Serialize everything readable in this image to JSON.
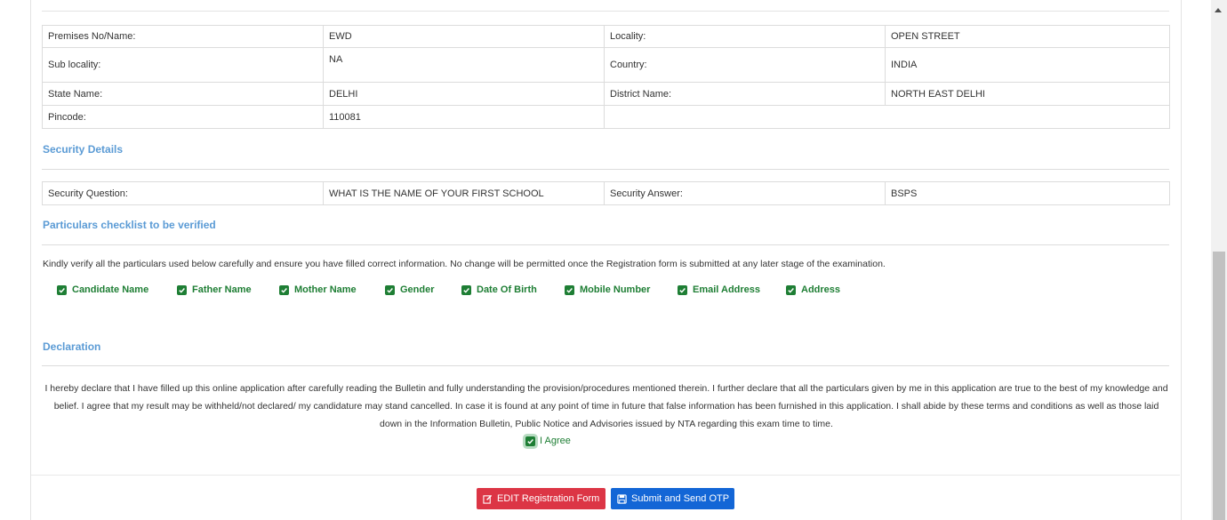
{
  "address_table": [
    {
      "label1": "Premises No/Name:",
      "value1": "EWD",
      "label2": "Locality:",
      "value2": "OPEN STREET"
    },
    {
      "label1": "Sub locality:",
      "value1": "NA",
      "label2": "Country:",
      "value2": "INDIA"
    },
    {
      "label1": "State Name:",
      "value1": "DELHI",
      "label2": "District Name:",
      "value2": "NORTH EAST DELHI"
    },
    {
      "label1": "Pincode:",
      "value1": "110081",
      "label2": "",
      "value2": ""
    }
  ],
  "security": {
    "title": "Security Details",
    "question_label": "Security Question:",
    "question_value": "WHAT IS THE NAME OF YOUR FIRST SCHOOL",
    "answer_label": "Security Answer:",
    "answer_value": "BSPS"
  },
  "checklist": {
    "title": "Particulars checklist to be verified",
    "instruction": "Kindly verify all the particulars used below carefully and ensure you have filled correct information. No change will be permitted once the Registration form is submitted at any later stage of the examination.",
    "items": [
      "Candidate Name",
      "Father Name",
      "Mother Name",
      "Gender",
      "Date Of Birth",
      "Mobile Number",
      "Email Address",
      "Address"
    ]
  },
  "declaration": {
    "title": "Declaration",
    "text": "I hereby declare that I have filled up this online application after carefully reading the Bulletin and fully understanding the provision/procedures mentioned therein. I further declare that all the particulars given by me in this application are true to the best of my knowledge and belief. I agree that my result may be withheld/not declared/ my candidature may stand cancelled. In case it is found at any point of time in future that false information has been furnished in this application. I shall abide by these terms and conditions as well as those laid down in the Information Bulletin, Public Notice and Advisories issued by NTA regarding this exam time to time.",
    "agree_label": "I Agree"
  },
  "buttons": {
    "edit_label": "EDIT Registration Form",
    "submit_label": "Submit and Send OTP"
  },
  "colors": {
    "section_title": "#5b9bd5",
    "check_green": "#1e7e34",
    "edit_button": "#dc3545",
    "submit_button": "#1366d6"
  },
  "icons": {
    "checkbox": "checked-checkbox-icon",
    "edit": "edit-icon",
    "save": "save-icon"
  }
}
